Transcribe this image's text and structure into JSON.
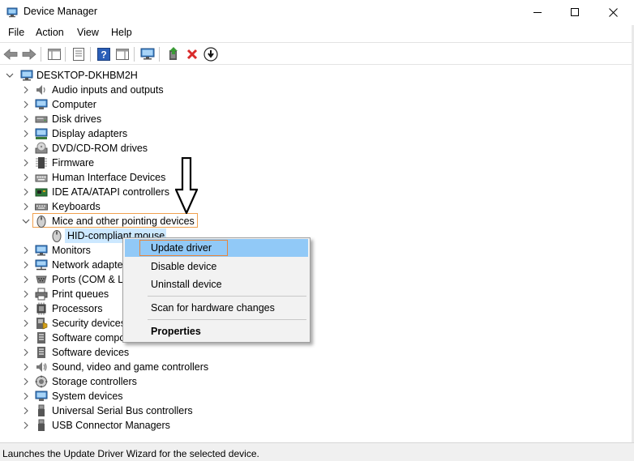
{
  "window": {
    "title": "Device Manager"
  },
  "menu": {
    "items": [
      "File",
      "Action",
      "View",
      "Help"
    ]
  },
  "toolbar": {
    "icons": [
      "back-arrow-icon",
      "forward-arrow-icon",
      "show-hide-tree-icon",
      "properties-sheet-icon",
      "help-icon",
      "action-pane-icon",
      "monitor-icon",
      "add-driver-icon",
      "uninstall-x-icon",
      "download-icon"
    ],
    "colors": {
      "green": "#3a9a35",
      "red": "#d92b2b",
      "blue": "#2b5fb8"
    }
  },
  "tree": {
    "root": "DESKTOP-DKHBM2H",
    "items": [
      {
        "label": "Audio inputs and outputs",
        "icon": "speaker-icon"
      },
      {
        "label": "Computer",
        "icon": "computer-icon"
      },
      {
        "label": "Disk drives",
        "icon": "disk-drive-icon"
      },
      {
        "label": "Display adapters",
        "icon": "display-adapter-icon"
      },
      {
        "label": "DVD/CD-ROM drives",
        "icon": "dvd-drive-icon"
      },
      {
        "label": "Firmware",
        "icon": "firmware-chip-icon"
      },
      {
        "label": "Human Interface Devices",
        "icon": "hid-icon"
      },
      {
        "label": "IDE ATA/ATAPI controllers",
        "icon": "ide-controller-icon"
      },
      {
        "label": "Keyboards",
        "icon": "keyboard-icon"
      },
      {
        "label": "Mice and other pointing devices",
        "icon": "mouse-icon"
      },
      {
        "label": "HID-compliant mouse",
        "icon": "mouse-icon"
      },
      {
        "label": "Monitors",
        "icon": "monitor-icon"
      },
      {
        "label": "Network adapters",
        "icon": "network-adapter-icon"
      },
      {
        "label": "Ports (COM & LPT)",
        "icon": "port-icon"
      },
      {
        "label": "Print queues",
        "icon": "printer-icon"
      },
      {
        "label": "Processors",
        "icon": "processor-icon"
      },
      {
        "label": "Security devices",
        "icon": "security-device-icon"
      },
      {
        "label": "Software components",
        "icon": "software-component-icon"
      },
      {
        "label": "Software devices",
        "icon": "software-device-icon"
      },
      {
        "label": "Sound, video and game controllers",
        "icon": "sound-icon"
      },
      {
        "label": "Storage controllers",
        "icon": "storage-controller-icon"
      },
      {
        "label": "System devices",
        "icon": "system-device-icon"
      },
      {
        "label": "Universal Serial Bus controllers",
        "icon": "usb-icon"
      },
      {
        "label": "USB Connector Managers",
        "icon": "usb-connector-icon"
      }
    ]
  },
  "context_menu": {
    "items": [
      "Update driver",
      "Disable device",
      "Uninstall device",
      "Scan for hardware changes",
      "Properties"
    ]
  },
  "status": {
    "text": "Launches the Update Driver Wizard for the selected device."
  }
}
